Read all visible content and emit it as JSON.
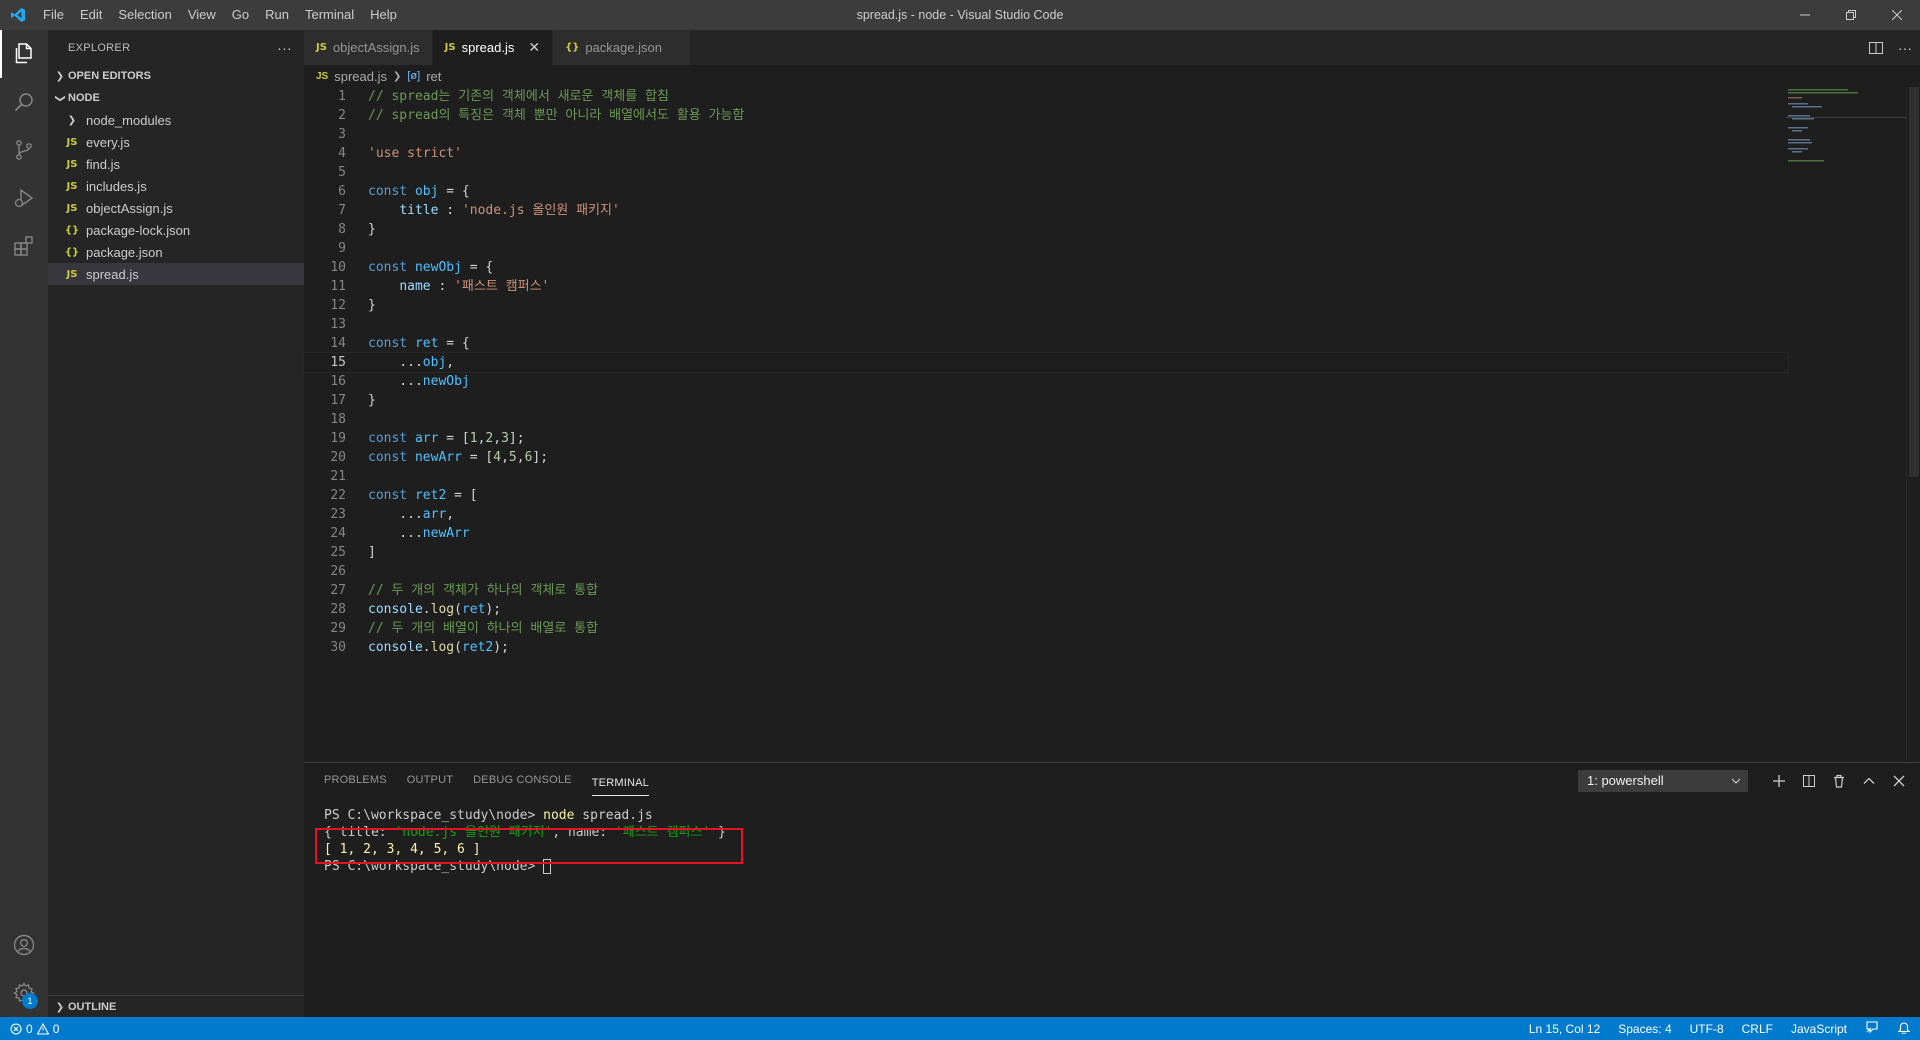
{
  "window": {
    "title": "spread.js - node - Visual Studio Code",
    "menu": [
      "File",
      "Edit",
      "Selection",
      "View",
      "Go",
      "Run",
      "Terminal",
      "Help"
    ]
  },
  "sidebar": {
    "title": "EXPLORER",
    "more": "···",
    "open_editors": "OPEN EDITORS",
    "folder": "NODE",
    "items": [
      {
        "label": "node_modules",
        "icon": "folder-chevron"
      },
      {
        "label": "every.js",
        "icon": "JS"
      },
      {
        "label": "find.js",
        "icon": "JS"
      },
      {
        "label": "includes.js",
        "icon": "JS"
      },
      {
        "label": "objectAssign.js",
        "icon": "JS"
      },
      {
        "label": "package-lock.json",
        "icon": "{}"
      },
      {
        "label": "package.json",
        "icon": "{}"
      },
      {
        "label": "spread.js",
        "icon": "JS"
      }
    ],
    "outline": "OUTLINE"
  },
  "tabs": [
    {
      "label": "objectAssign.js",
      "icon": "JS"
    },
    {
      "label": "spread.js",
      "icon": "JS",
      "active": true
    },
    {
      "label": "package.json",
      "icon": "{}"
    }
  ],
  "breadcrumb": {
    "file": "spread.js",
    "symbol": "ret",
    "file_icon": "JS",
    "symbol_icon": "[ø]"
  },
  "code": {
    "lines": [
      [
        [
          "c-cmt",
          "// spread는 기존의 객체에서 새로운 객체를 합침"
        ]
      ],
      [
        [
          "c-cmt",
          "// spread의 특징은 객체 뿐만 아니라 배열에서도 활용 가능함"
        ]
      ],
      [],
      [
        [
          "c-str",
          "'use strict'"
        ]
      ],
      [],
      [
        [
          "c-kw",
          "const "
        ],
        [
          "c-var",
          "obj"
        ],
        [
          "c-pun",
          " = {"
        ]
      ],
      [
        [
          "c-pun",
          "    "
        ],
        [
          "c-prop",
          "title"
        ],
        [
          "c-pun",
          " : "
        ],
        [
          "c-str",
          "'node.js 올인원 패키지'"
        ]
      ],
      [
        [
          "c-pun",
          "}"
        ]
      ],
      [],
      [
        [
          "c-kw",
          "const "
        ],
        [
          "c-var",
          "newObj"
        ],
        [
          "c-pun",
          " = {"
        ]
      ],
      [
        [
          "c-pun",
          "    "
        ],
        [
          "c-prop",
          "name"
        ],
        [
          "c-pun",
          " : "
        ],
        [
          "c-str",
          "'패스트 캠퍼스'"
        ]
      ],
      [
        [
          "c-pun",
          "}"
        ]
      ],
      [],
      [
        [
          "c-kw",
          "const "
        ],
        [
          "c-var",
          "ret"
        ],
        [
          "c-pun",
          " = {"
        ]
      ],
      [
        [
          "c-pun",
          "    ..."
        ],
        [
          "c-var",
          "obj"
        ],
        [
          "c-pun",
          ","
        ]
      ],
      [
        [
          "c-pun",
          "    ..."
        ],
        [
          "c-var",
          "newObj"
        ]
      ],
      [
        [
          "c-pun",
          "}"
        ]
      ],
      [],
      [
        [
          "c-kw",
          "const "
        ],
        [
          "c-var",
          "arr"
        ],
        [
          "c-pun",
          " = ["
        ],
        [
          "c-num",
          "1"
        ],
        [
          "c-pun",
          ","
        ],
        [
          "c-num",
          "2"
        ],
        [
          "c-pun",
          ","
        ],
        [
          "c-num",
          "3"
        ],
        [
          "c-pun",
          "];"
        ]
      ],
      [
        [
          "c-kw",
          "const "
        ],
        [
          "c-var",
          "newArr"
        ],
        [
          "c-pun",
          " = ["
        ],
        [
          "c-num",
          "4"
        ],
        [
          "c-pun",
          ","
        ],
        [
          "c-num",
          "5"
        ],
        [
          "c-pun",
          ","
        ],
        [
          "c-num",
          "6"
        ],
        [
          "c-pun",
          "];"
        ]
      ],
      [],
      [
        [
          "c-kw",
          "const "
        ],
        [
          "c-var",
          "ret2"
        ],
        [
          "c-pun",
          " = ["
        ]
      ],
      [
        [
          "c-pun",
          "    ..."
        ],
        [
          "c-var",
          "arr"
        ],
        [
          "c-pun",
          ","
        ]
      ],
      [
        [
          "c-pun",
          "    ..."
        ],
        [
          "c-var",
          "newArr"
        ]
      ],
      [
        [
          "c-pun",
          "]"
        ]
      ],
      [],
      [
        [
          "c-cmt",
          "// 두 개의 객체가 하나의 객체로 통합"
        ]
      ],
      [
        [
          "c-prop",
          "console"
        ],
        [
          "c-pun",
          "."
        ],
        [
          "c-fn",
          "log"
        ],
        [
          "c-pun",
          "("
        ],
        [
          "c-var",
          "ret"
        ],
        [
          "c-pun",
          ");"
        ]
      ],
      [
        [
          "c-cmt",
          "// 두 개의 배열이 하나의 배열로 통합"
        ]
      ],
      [
        [
          "c-prop",
          "console"
        ],
        [
          "c-pun",
          "."
        ],
        [
          "c-fn",
          "log"
        ],
        [
          "c-pun",
          "("
        ],
        [
          "c-var",
          "ret2"
        ],
        [
          "c-pun",
          ");"
        ]
      ]
    ],
    "current_line": 15
  },
  "panel": {
    "tabs": [
      "PROBLEMS",
      "OUTPUT",
      "DEBUG CONSOLE",
      "TERMINAL"
    ],
    "active_tab": "TERMINAL",
    "terminal_select": "1: powershell",
    "terminal": {
      "prompt1": "PS C:\\workspace_study\\node> ",
      "cmd_name": "node",
      "cmd_arg": " spread.js",
      "out1_a": "{ title: ",
      "out1_b": "'node.js 올인원 패키지'",
      "out1_c": ", name: ",
      "out1_d": "'패스트 캠퍼스'",
      "out1_e": " }",
      "out2": "[ 1, 2, 3, 4, 5, 6 ]",
      "prompt2": "PS C:\\workspace_study\\node> "
    }
  },
  "statusbar": {
    "errors": "0",
    "warnings": "0",
    "position": "Ln 15, Col 12",
    "spaces": "Spaces: 4",
    "encoding": "UTF-8",
    "eol": "CRLF",
    "language": "JavaScript"
  },
  "colors": {
    "accent": "#007acc",
    "highlight_box": "#e81123"
  }
}
